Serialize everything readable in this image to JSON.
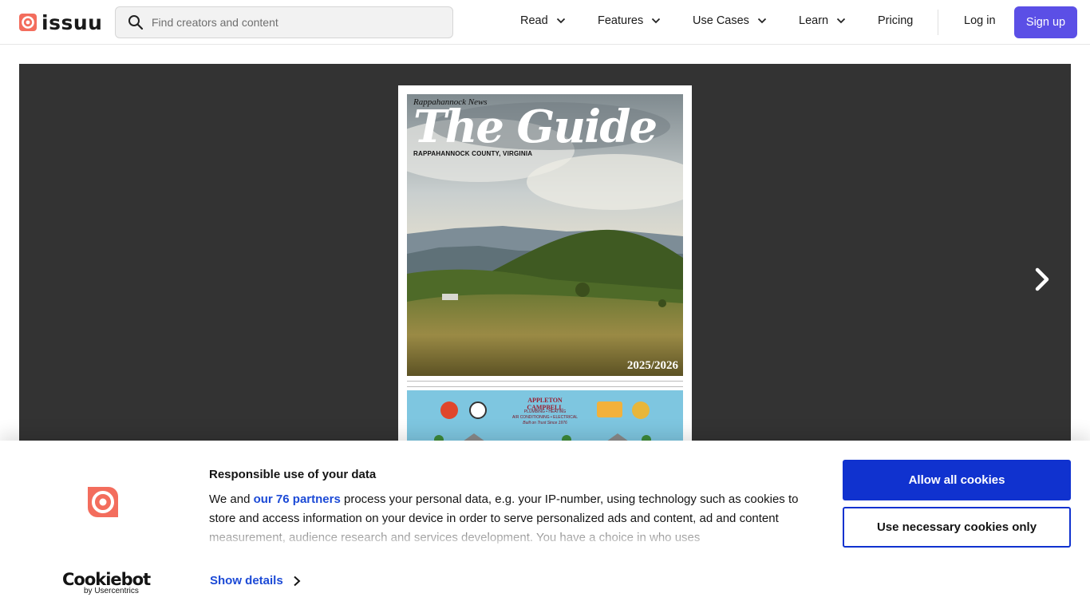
{
  "brand": {
    "name": "issuu",
    "logo_icon": "issuu-logo-icon",
    "accent": "#f36d5d"
  },
  "search": {
    "placeholder": "Find creators and content",
    "icon": "search-icon"
  },
  "nav": {
    "items": [
      {
        "label": "Read",
        "has_dropdown": true
      },
      {
        "label": "Features",
        "has_dropdown": true
      },
      {
        "label": "Use Cases",
        "has_dropdown": true
      },
      {
        "label": "Learn",
        "has_dropdown": true
      },
      {
        "label": "Pricing",
        "has_dropdown": false
      }
    ],
    "login": "Log in",
    "signup": "Sign up",
    "signup_color": "#5b4fe6"
  },
  "reader": {
    "background": "#333333",
    "cover": {
      "masthead": "Rappahannock News",
      "title": "The Guide",
      "subtitle": "RAPPAHANNOCK COUNTY, VIRGINIA",
      "year": "2025/2026",
      "ad_brand": "APPLETON CAMPBELL",
      "ad_lines": [
        "PLUMBING • HEATING",
        "AIR CONDITIONING • ELECTRICAL",
        "Built on Trust Since 1976"
      ]
    },
    "next_icon": "chevron-right-icon"
  },
  "cookie_banner": {
    "title": "Responsible use of your data",
    "text_before": "We and ",
    "partners_link": "our 76 partners",
    "text_after": " process your personal data, e.g. your IP-number, using technology such as cookies to store and access information on your device in order to serve personalized ads and content, ad and content measurement, audience research and services development. You have a choice in who uses",
    "show_details": "Show details",
    "allow_all": "Allow all cookies",
    "necessary_only": "Use necessary cookies only",
    "brand_name": "Cookiebot",
    "brand_sub": "by Usercentrics",
    "primary_color": "#1032cf",
    "link_color": "#1c4ad6"
  }
}
